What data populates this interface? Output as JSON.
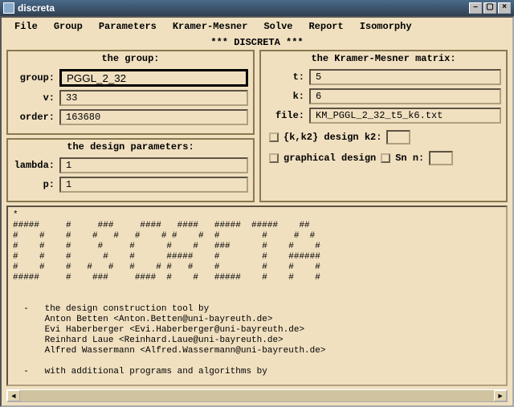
{
  "window": {
    "title": "discreta"
  },
  "menu": [
    "File",
    "Group",
    "Parameters",
    "Kramer-Mesner",
    "Solve",
    "Report",
    "Isomorphy"
  ],
  "banner": "*** DISCRETA ***",
  "group_box": {
    "title": "the group:",
    "fields": {
      "group_label": "group:",
      "group_value": "PGGL_2_32",
      "v_label": "v:",
      "v_value": "33",
      "order_label": "order:",
      "order_value": "163680"
    }
  },
  "design_box": {
    "title": "the design parameters:",
    "fields": {
      "lambda_label": "lambda:",
      "lambda_value": "1",
      "p_label": "p:",
      "p_value": "1"
    }
  },
  "km_box": {
    "title": "the Kramer-Mesner matrix:",
    "fields": {
      "t_label": "t:",
      "t_value": "5",
      "k_label": "k:",
      "k_value": "6",
      "file_label": "file:",
      "file_value": "KM_PGGL_2_32_t5_k6.txt"
    },
    "kk2_label": "{k,k2} design  k2:",
    "kk2_value": "",
    "graphical_label": "graphical design",
    "sn_label": "Sn   n:",
    "sn_value": ""
  },
  "output_text": "*\n#####     #     ###     ####   ####   #####  #####    ##\n#    #    #    #   #   #    # #    #  #        #     #  #\n#    #    #     #     #      #    #   ###      #    #    #\n#    #    #      #    #      #####    #        #    ######\n#    #    #   #   #   #    # #   #    #        #    #    #\n#####     #    ###     ####  #    #   #####    #    #    #\n\n\n  -   the design construction tool by\n      Anton Betten <Anton.Betten@uni-bayreuth.de>\n      Evi Haberberger <Evi.Haberberger@uni-bayreuth.de>\n      Reinhard Laue <Reinhard.Laue@uni-bayreuth.de>\n      Alfred Wassermann <Alfred.Wassermann@uni-bayreuth.de>\n\n  -   with additional programs and algorithms by"
}
